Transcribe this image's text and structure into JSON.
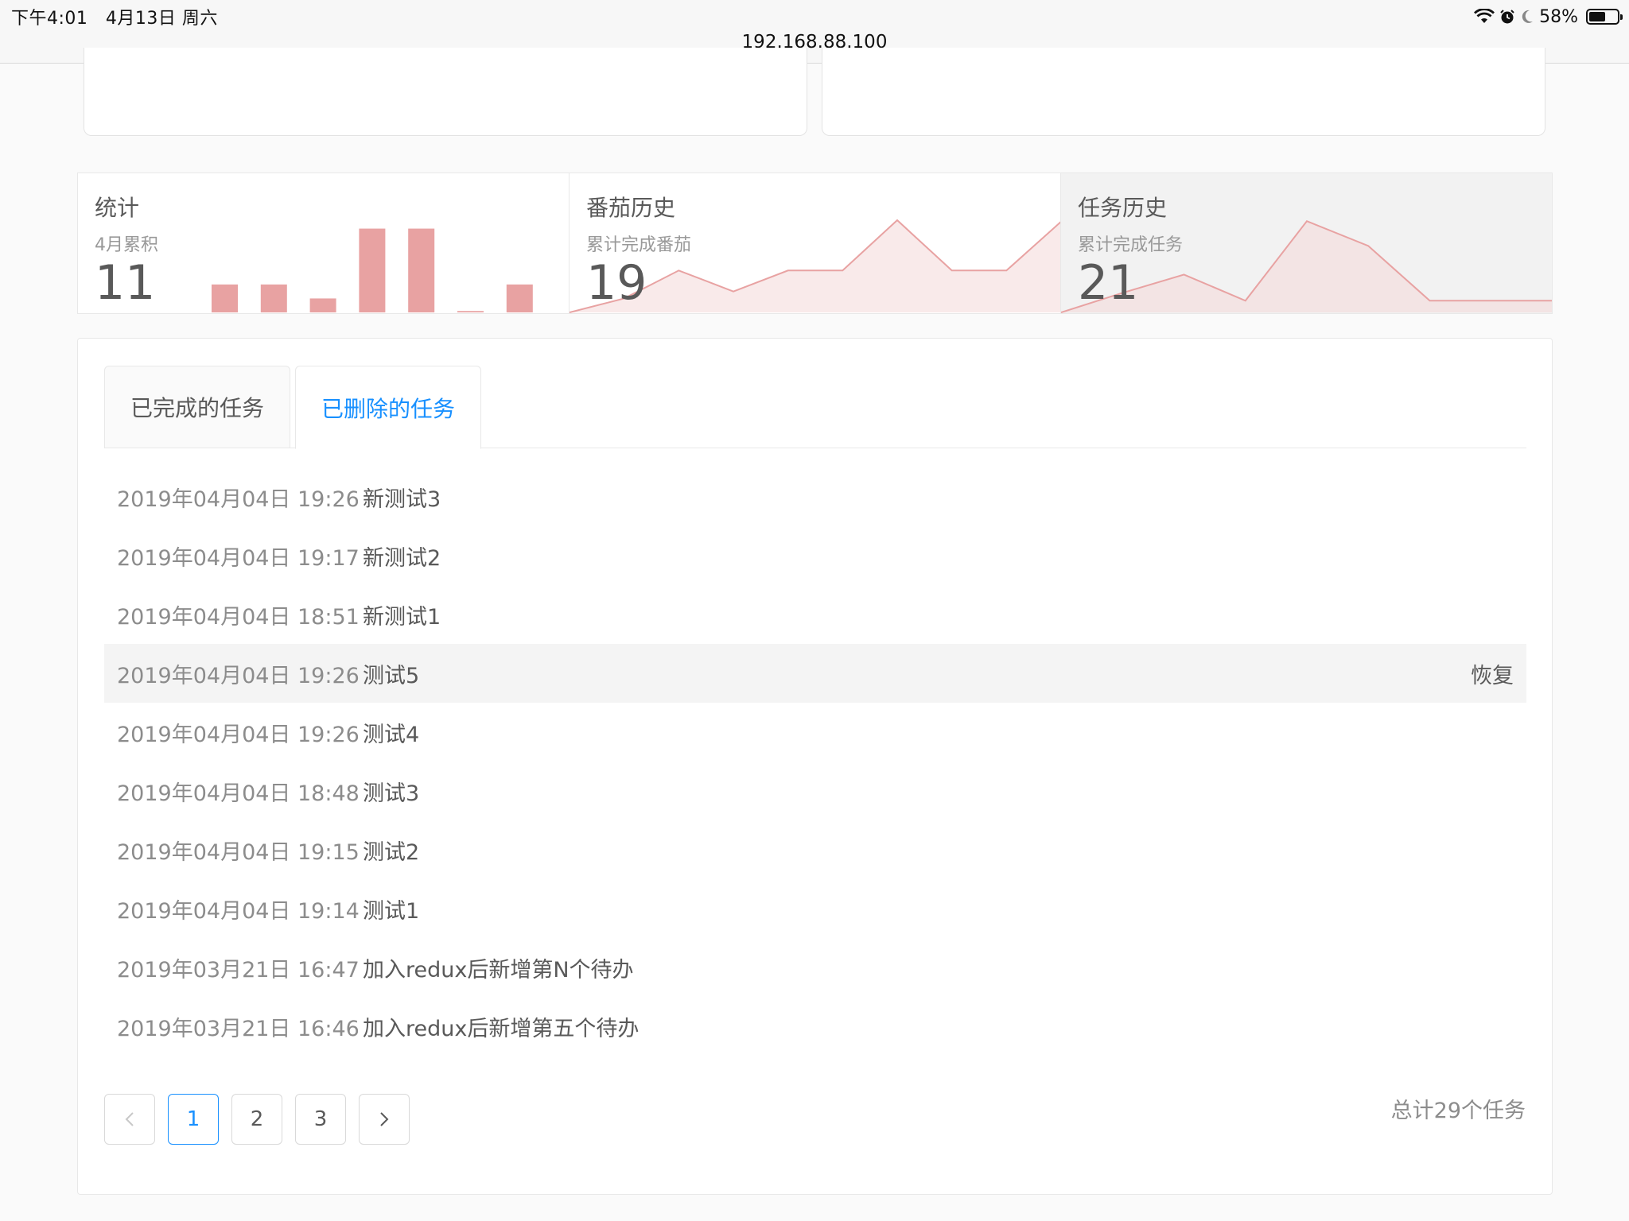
{
  "status_bar": {
    "time": "下午4:01",
    "date": "4月13日 周六",
    "battery_text": "58%",
    "battery_level": 0.58,
    "url": "192.168.88.100",
    "icons": [
      "wifi-icon",
      "alarm-icon",
      "moon-icon",
      "battery-icon"
    ]
  },
  "stats": [
    {
      "title": "统计",
      "subtitle": "4月累积",
      "value": "11",
      "chart_data": {
        "type": "bar",
        "values": [
          2,
          2,
          1,
          6,
          6,
          0.1,
          2
        ],
        "ylim": [
          0,
          7
        ],
        "color": "#e8a2a2"
      }
    },
    {
      "title": "番茄历史",
      "subtitle": "累计完成番茄",
      "value": "19",
      "chart_data": {
        "type": "area",
        "values": [
          0,
          1,
          3,
          1.5,
          3,
          3,
          6.6,
          3,
          3,
          6.5
        ],
        "ylim": [
          0,
          7
        ],
        "color": "#e8a2a2"
      }
    },
    {
      "title": "任务历史",
      "subtitle": "累计完成任务",
      "value": "21",
      "chart_data": {
        "type": "area",
        "values": [
          0,
          1.5,
          2.9,
          0.9,
          7.0,
          5.1,
          0.9,
          0.9,
          0.9
        ],
        "ylim": [
          0,
          7.5
        ],
        "color": "#e8a2a2"
      }
    }
  ],
  "tabs": [
    {
      "label": "已完成的任务",
      "active": false
    },
    {
      "label": "已删除的任务",
      "active": true
    }
  ],
  "tasks": [
    {
      "time": "2019年04月04日 19:26",
      "name": "新测试3"
    },
    {
      "time": "2019年04月04日 19:17",
      "name": "新测试2"
    },
    {
      "time": "2019年04月04日 18:51",
      "name": "新测试1"
    },
    {
      "time": "2019年04月04日 19:26",
      "name": "测试5",
      "action": "恢复"
    },
    {
      "time": "2019年04月04日 19:26",
      "name": "测试4"
    },
    {
      "time": "2019年04月04日 18:48",
      "name": "测试3"
    },
    {
      "time": "2019年04月04日 19:15",
      "name": "测试2"
    },
    {
      "time": "2019年04月04日 19:14",
      "name": "测试1"
    },
    {
      "time": "2019年03月21日 16:47",
      "name": "加入redux后新增第N个待办"
    },
    {
      "time": "2019年03月21日 16:46",
      "name": "加入redux后新增第五个待办"
    }
  ],
  "pagination": {
    "prev": "<",
    "pages": [
      "1",
      "2",
      "3"
    ],
    "current": "1",
    "next": ">",
    "total_text": "总计29个任务"
  },
  "colors": {
    "accent": "#1890ff",
    "chart": "#e8a2a2",
    "chart_fill": "#f4d8d8"
  }
}
